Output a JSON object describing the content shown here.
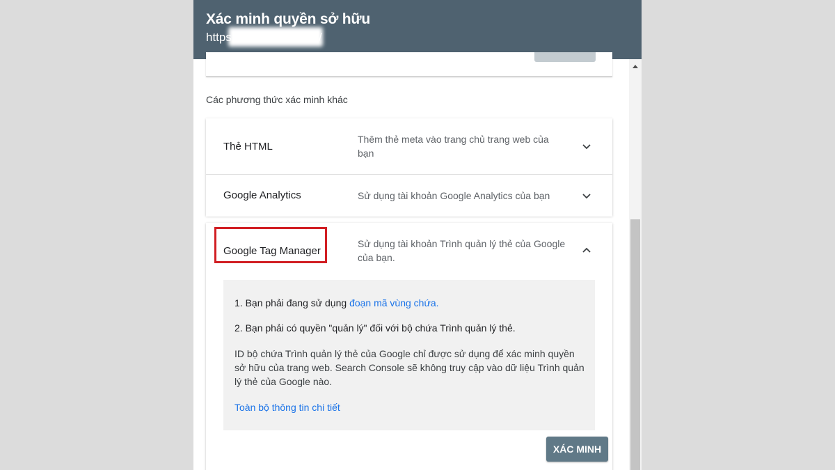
{
  "header": {
    "title": "Xác minh quyền sở hữu",
    "url_prefix": "https:",
    "url_suffix": "/",
    "background": "#4f6270"
  },
  "section_label": "Các phương thức xác minh khác",
  "methods": [
    {
      "name": "Thẻ HTML",
      "description": "Thêm thẻ meta vào trang chủ trang web của bạn",
      "expanded": false,
      "chevron_icon": "chevron-down-icon"
    },
    {
      "name": "Google Analytics",
      "description": "Sử dụng tài khoản Google Analytics của bạn",
      "expanded": false,
      "chevron_icon": "chevron-down-icon"
    },
    {
      "name": "Google Tag Manager",
      "description": "Sử dụng tài khoản Trình quản lý thẻ của Google của bạn.",
      "expanded": true,
      "chevron_icon": "chevron-up-icon",
      "highlight_color": "#d11f24"
    }
  ],
  "gtm_panel": {
    "step1_text": "1. Bạn phải đang sử dụng ",
    "step1_link": "đoạn mã vùng chứa.",
    "step2_text": "2. Bạn phải có quyền \"quản lý\" đối với bộ chứa Trình quản lý thẻ.",
    "note": "ID bộ chứa Trình quản lý thẻ của Google chỉ được sử dụng để xác minh quyền sở hữu của trang web. Search Console sẽ không truy cập vào dữ liệu Trình quản lý thẻ của Google nào.",
    "details_link": "Toàn bộ thông tin chi tiết",
    "link_color": "#1a73e8"
  },
  "verify_button": {
    "label": "XÁC MINH",
    "background": "#607987"
  }
}
